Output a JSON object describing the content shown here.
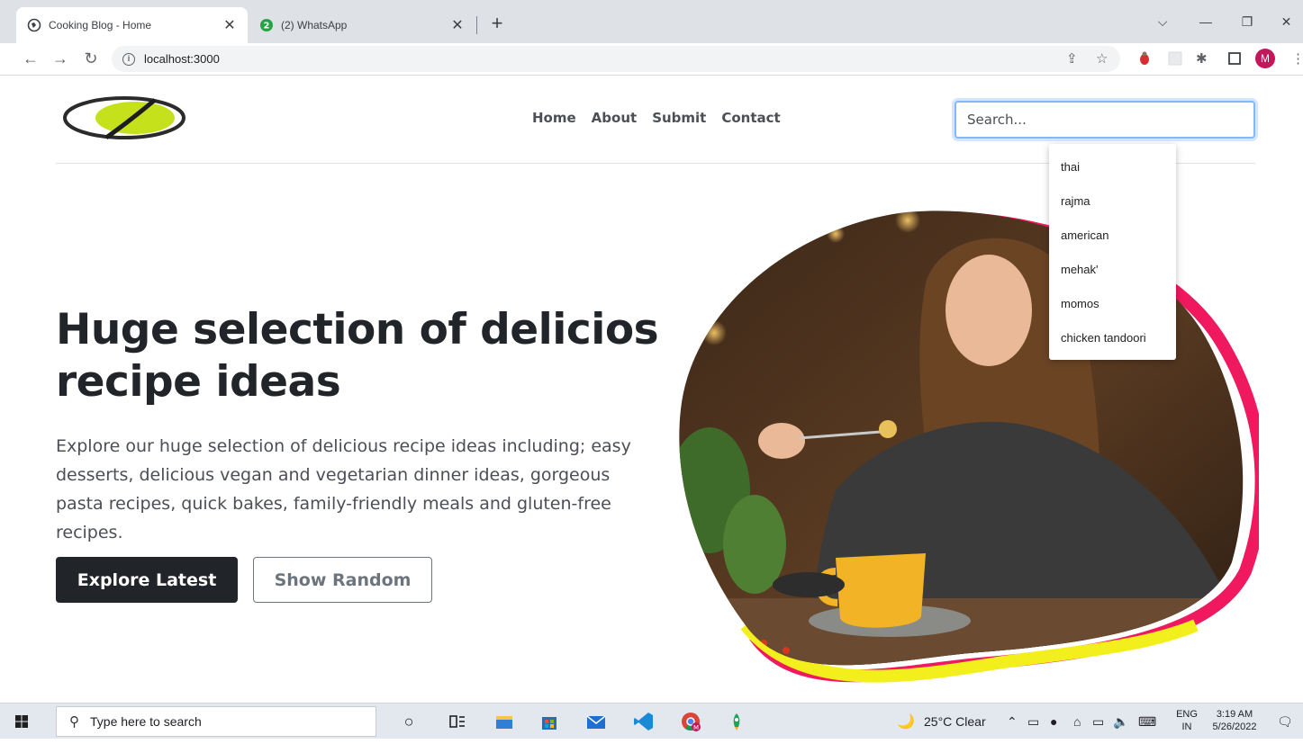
{
  "browser": {
    "tabs": [
      {
        "title": "Cooking Blog - Home",
        "active": true
      },
      {
        "title": "(2) WhatsApp",
        "active": false,
        "badge": "2"
      }
    ],
    "url": "localhost:3000",
    "profile_initial": "M"
  },
  "site": {
    "nav": [
      "Home",
      "About",
      "Submit",
      "Contact"
    ],
    "search": {
      "placeholder": "Search...",
      "suggestions": [
        "thai",
        "rajma",
        "american",
        "mehak'",
        "momos",
        "chicken tandoori"
      ]
    },
    "hero": {
      "title": "Huge selection of delicios recipe ideas",
      "text": "Explore our huge selection of delicious recipe ideas including; easy desserts, delicious vegan and vegetarian dinner ideas, gorgeous pasta recipes, quick bakes, family-friendly meals and gluten-free recipes.",
      "primary_button": "Explore Latest",
      "secondary_button": "Show Random"
    }
  },
  "taskbar": {
    "search_placeholder": "Type here to search",
    "weather": "25°C  Clear",
    "lang_top": "ENG",
    "lang_bottom": "IN",
    "time": "3:19 AM",
    "date": "5/26/2022"
  },
  "colors": {
    "accent_pink": "#f0185e",
    "accent_yellow": "#f2ef1c",
    "dark_button": "#212529",
    "logo_green": "#c5e11b"
  }
}
